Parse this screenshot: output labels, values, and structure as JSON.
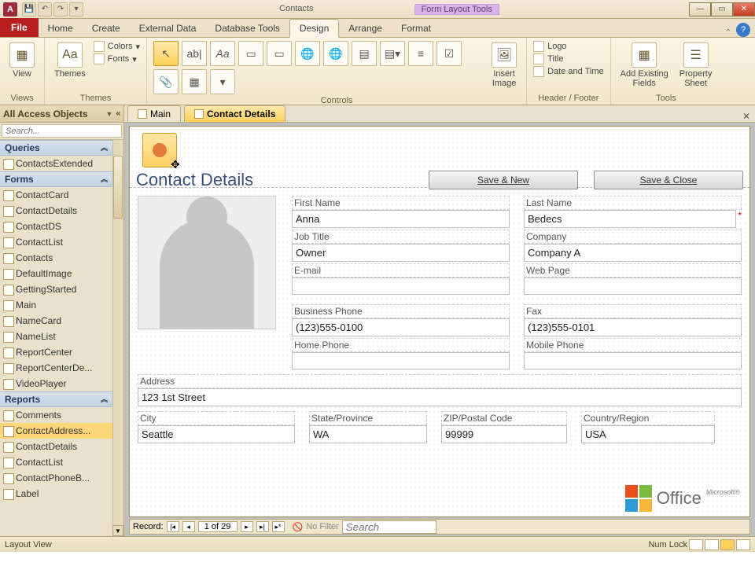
{
  "titlebar": {
    "doc": "Contacts",
    "tool_context": "Form Layout Tools"
  },
  "tabs": {
    "file": "File",
    "items": [
      "Home",
      "Create",
      "External Data",
      "Database Tools",
      "Design",
      "Arrange",
      "Format"
    ],
    "active": "Design"
  },
  "ribbon": {
    "views": {
      "label": "Views",
      "view_btn": "View"
    },
    "themes": {
      "label": "Themes",
      "themes_btn": "Themes",
      "colors": "Colors",
      "fonts": "Fonts"
    },
    "controls": {
      "label": "Controls",
      "insert_image": "Insert\nImage"
    },
    "header_footer": {
      "label": "Header / Footer",
      "logo": "Logo",
      "title": "Title",
      "date_time": "Date and Time"
    },
    "tools": {
      "label": "Tools",
      "add_fields": "Add Existing\nFields",
      "prop_sheet": "Property\nSheet"
    }
  },
  "nav": {
    "header": "All Access Objects",
    "search_placeholder": "Search...",
    "groups": [
      {
        "name": "Queries",
        "items": [
          "ContactsExtended"
        ]
      },
      {
        "name": "Forms",
        "items": [
          "ContactCard",
          "ContactDetails",
          "ContactDS",
          "ContactList",
          "Contacts",
          "DefaultImage",
          "GettingStarted",
          "Main",
          "NameCard",
          "NameList",
          "ReportCenter",
          "ReportCenterDe...",
          "VideoPlayer"
        ]
      },
      {
        "name": "Reports",
        "items": [
          "Comments",
          "ContactAddress...",
          "ContactDetails",
          "ContactList",
          "ContactPhoneB...",
          "Label"
        ]
      }
    ],
    "selected": "ContactAddress..."
  },
  "doc_tabs": {
    "items": [
      "Main",
      "Contact Details"
    ],
    "active": "Contact Details"
  },
  "form": {
    "title": "Contact Details",
    "save_new": "Save & New",
    "save_close": "Save & Close",
    "labels": {
      "first_name": "First Name",
      "last_name": "Last Name",
      "job_title": "Job Title",
      "company": "Company",
      "email": "E-mail",
      "web_page": "Web Page",
      "bus_phone": "Business Phone",
      "fax": "Fax",
      "home_phone": "Home Phone",
      "mobile_phone": "Mobile Phone",
      "address": "Address",
      "city": "City",
      "state": "State/Province",
      "zip": "ZIP/Postal Code",
      "country": "Country/Region"
    },
    "values": {
      "first_name": "Anna",
      "last_name": "Bedecs",
      "job_title": "Owner",
      "company": "Company A",
      "email": "",
      "web_page": "",
      "bus_phone": "(123)555-0100",
      "fax": "(123)555-0101",
      "home_phone": "",
      "mobile_phone": "",
      "address": "123 1st Street",
      "city": "Seattle",
      "state": "WA",
      "zip": "99999",
      "country": "USA"
    }
  },
  "recnav": {
    "label": "Record:",
    "pos": "1 of 29",
    "nofilter": "No Filter",
    "search_placeholder": "Search"
  },
  "status": {
    "view": "Layout View",
    "numlock": "Num Lock"
  },
  "office_logo": {
    "text": "Office",
    "brand": "Microsoft®"
  }
}
